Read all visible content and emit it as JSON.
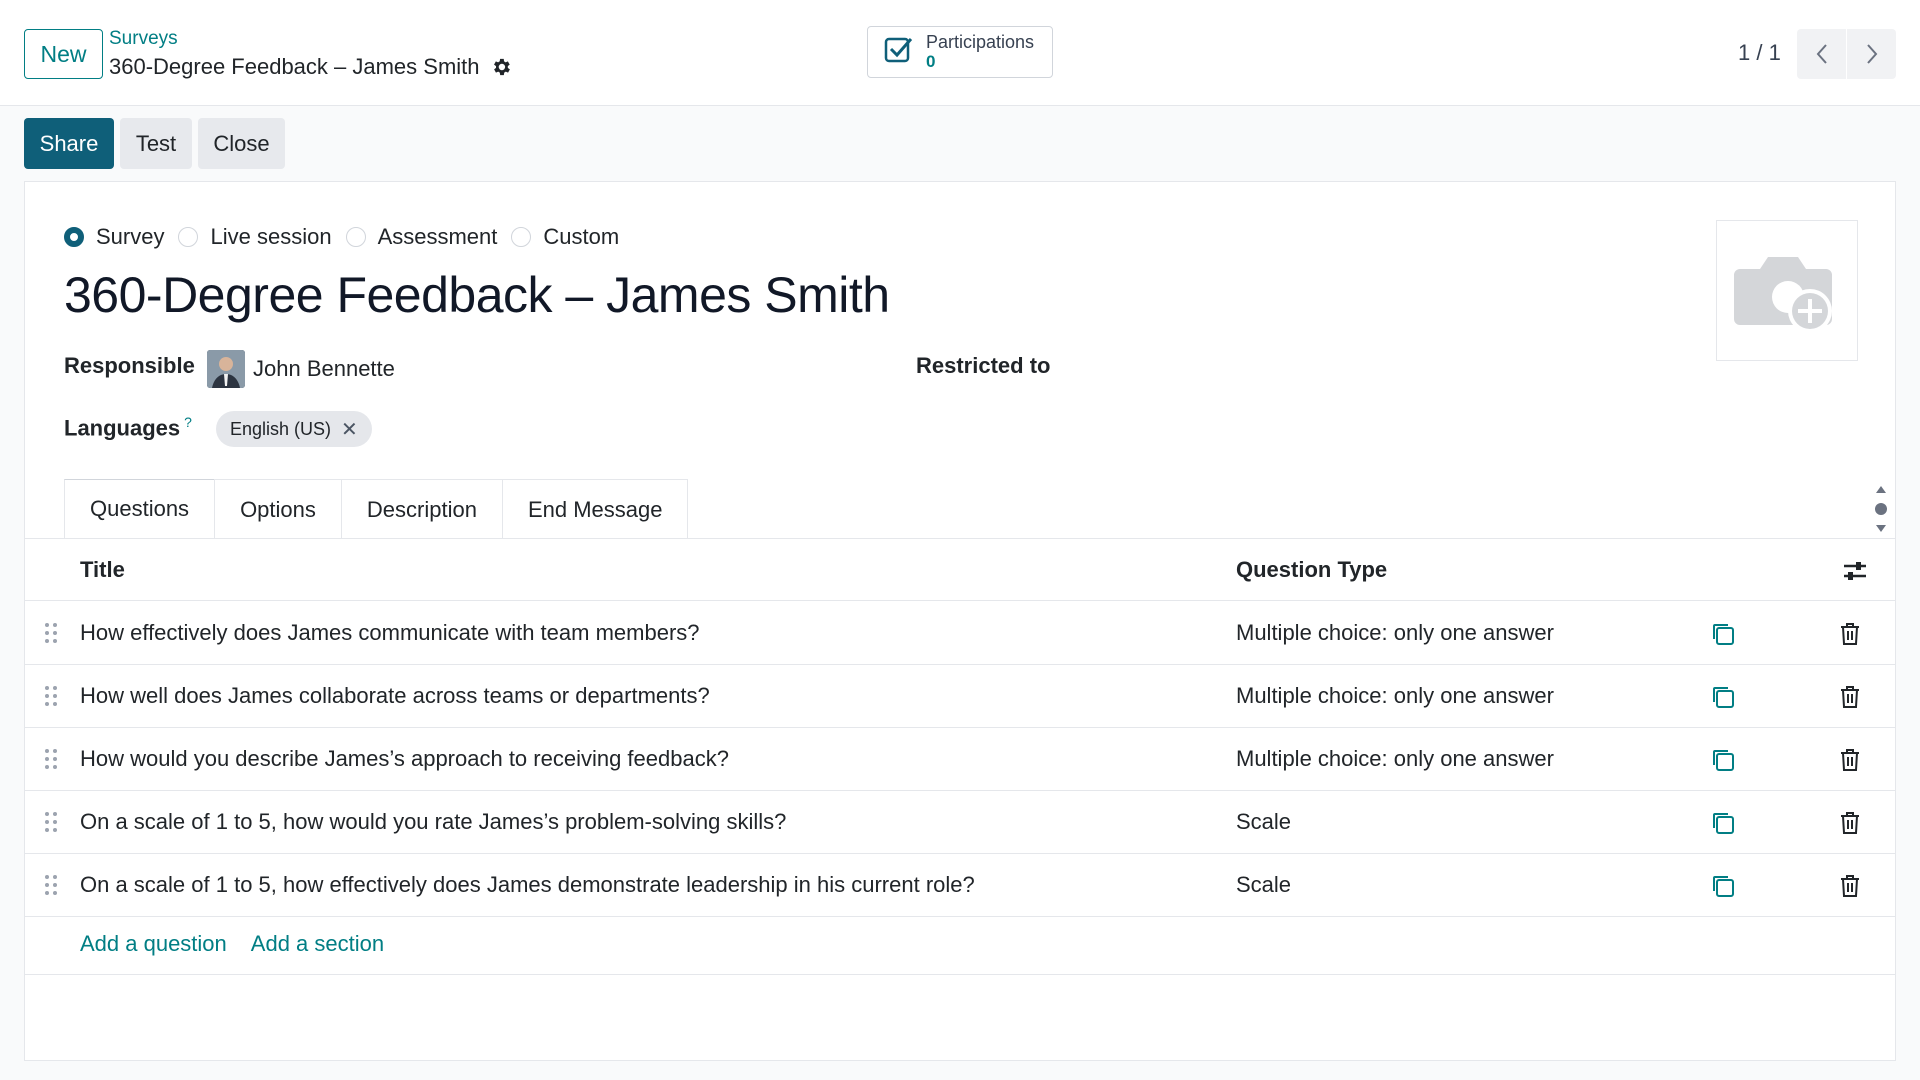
{
  "header": {
    "new_label": "New",
    "breadcrumb_parent": "Surveys",
    "breadcrumb_current": "360-Degree Feedback – James Smith",
    "participations_label": "Participations",
    "participations_count": "0",
    "pager": "1 / 1"
  },
  "actions": {
    "share": "Share",
    "test": "Test",
    "close": "Close"
  },
  "form": {
    "survey_types": [
      {
        "label": "Survey",
        "checked": true
      },
      {
        "label": "Live session",
        "checked": false
      },
      {
        "label": "Assessment",
        "checked": false
      },
      {
        "label": "Custom",
        "checked": false
      }
    ],
    "title": "360-Degree Feedback – James Smith",
    "responsible_label": "Responsible",
    "responsible_value": "John Bennette",
    "restricted_label": "Restricted to",
    "languages_label": "Languages",
    "languages_help": "?",
    "language_tag": "English (US)",
    "language_tag_remove": "✕"
  },
  "tabs": [
    "Questions",
    "Options",
    "Description",
    "End Message"
  ],
  "table": {
    "headers": {
      "title": "Title",
      "type": "Question Type"
    },
    "rows": [
      {
        "title": "How effectively does James communicate with team members?",
        "type": "Multiple choice: only one answer"
      },
      {
        "title": "How well does James collaborate across teams or departments?",
        "type": "Multiple choice: only one answer"
      },
      {
        "title": "How would you describe James’s approach to receiving feedback?",
        "type": "Multiple choice: only one answer"
      },
      {
        "title": "On a scale of 1 to 5, how would you rate James’s problem-solving skills?",
        "type": "Scale"
      },
      {
        "title": "On a scale of 1 to 5, how effectively does James demonstrate leadership in his current role?",
        "type": "Scale"
      }
    ],
    "add_question": "Add a question",
    "add_section": "Add a section"
  },
  "colors": {
    "accent": "#017e84",
    "primary_button": "#0f5f79"
  }
}
